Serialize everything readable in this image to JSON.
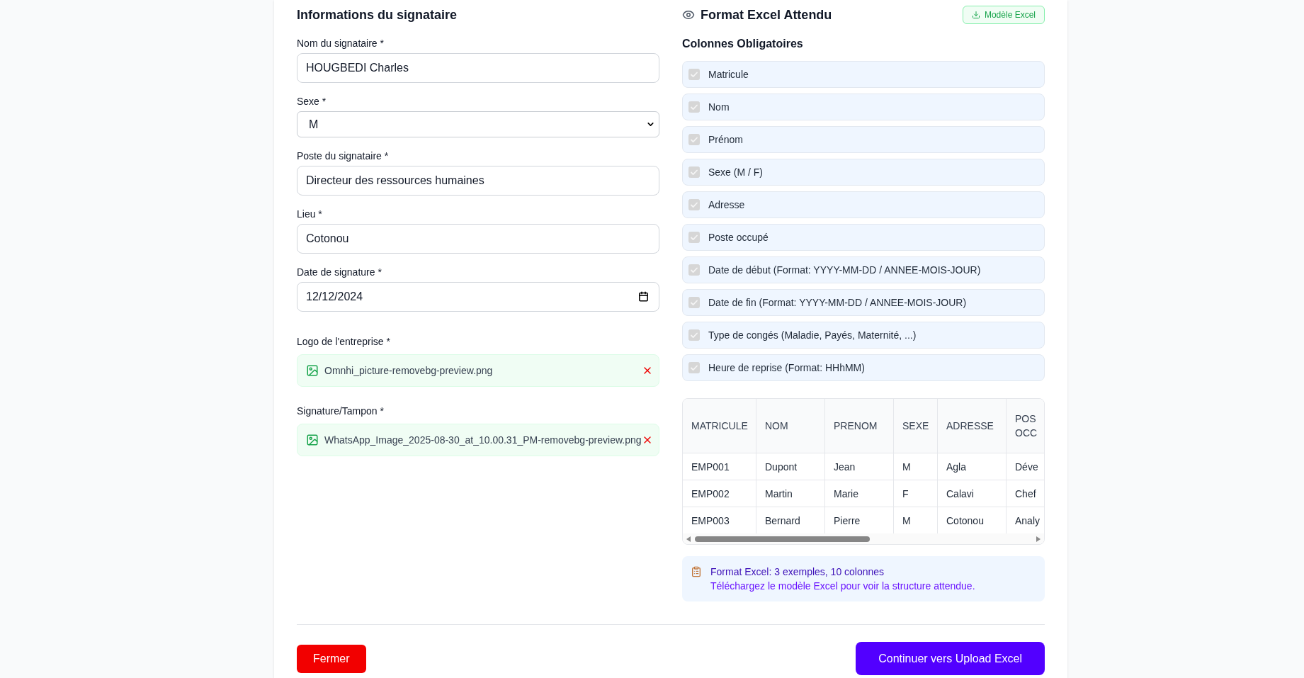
{
  "signatory": {
    "title": "Informations du signataire",
    "fields": [
      {
        "kind": "text",
        "label": "Nom du signataire *",
        "value": "HOUGBEDI Charles"
      },
      {
        "kind": "select",
        "label": "Sexe *",
        "value": "M"
      },
      {
        "kind": "text",
        "label": "Poste du signataire *",
        "value": "Directeur des ressources humaines"
      },
      {
        "kind": "text",
        "label": "Lieu *",
        "value": "Cotonou"
      },
      {
        "kind": "date",
        "label": "Date de signature *",
        "value": "12/12/2024"
      }
    ],
    "uploads": [
      {
        "label": "Logo de l'entreprise *",
        "file_name": "Omnhi_picture-removebg-preview.png"
      },
      {
        "label": "Signature/Tampon *",
        "file_name": "WhatsApp_Image_2025-08-30_at_10.00.31_PM-removebg-preview.png"
      }
    ]
  },
  "excel_format": {
    "title": "Format Excel Attendu",
    "template_button": "Modèle Excel",
    "columns_title": "Colonnes Obligatoires",
    "columns": [
      {
        "label": "Matricule",
        "checked": true,
        "disabled": true
      },
      {
        "label": "Nom",
        "checked": true,
        "disabled": true
      },
      {
        "label": "Prénom",
        "checked": true,
        "disabled": true
      },
      {
        "label": "Sexe (M / F)",
        "checked": true,
        "disabled": true
      },
      {
        "label": "Adresse",
        "checked": true,
        "disabled": true
      },
      {
        "label": "Poste occupé",
        "checked": true,
        "disabled": true
      },
      {
        "label": "Date de début (Format: YYYY-MM-DD / ANNEE-MOIS-JOUR)",
        "checked": true,
        "disabled": true
      },
      {
        "label": "Date de fin (Format: YYYY-MM-DD / ANNEE-MOIS-JOUR)",
        "checked": true,
        "disabled": true
      },
      {
        "label": "Type de congés (Maladie, Payés, Maternité, ...)",
        "checked": true,
        "disabled": true
      },
      {
        "label": "Heure de reprise (Format: HHhMM)",
        "checked": true,
        "disabled": true
      }
    ],
    "preview_table": {
      "columns": [
        "MATRICULE",
        "NOM",
        "PRENOM",
        "SEXE",
        "ADRESSE",
        "POS OCC"
      ],
      "rows": [
        [
          "EMP001",
          "Dupont",
          "Jean",
          "M",
          "Agla",
          "Déve"
        ],
        [
          "EMP002",
          "Martin",
          "Marie",
          "F",
          "Calavi",
          "Chef"
        ],
        [
          "EMP003",
          "Bernard",
          "Pierre",
          "M",
          "Cotonou",
          "Analy"
        ]
      ]
    },
    "info": {
      "summary": "Format Excel: 3 exemples, 10 colonnes",
      "hint": "Téléchargez le modèle Excel pour voir la structure attendue."
    }
  },
  "footer": {
    "buttons": [
      {
        "kind": "danger",
        "label": "Fermer"
      },
      {
        "kind": "primary",
        "label": "Continuer vers Upload Excel"
      }
    ]
  }
}
